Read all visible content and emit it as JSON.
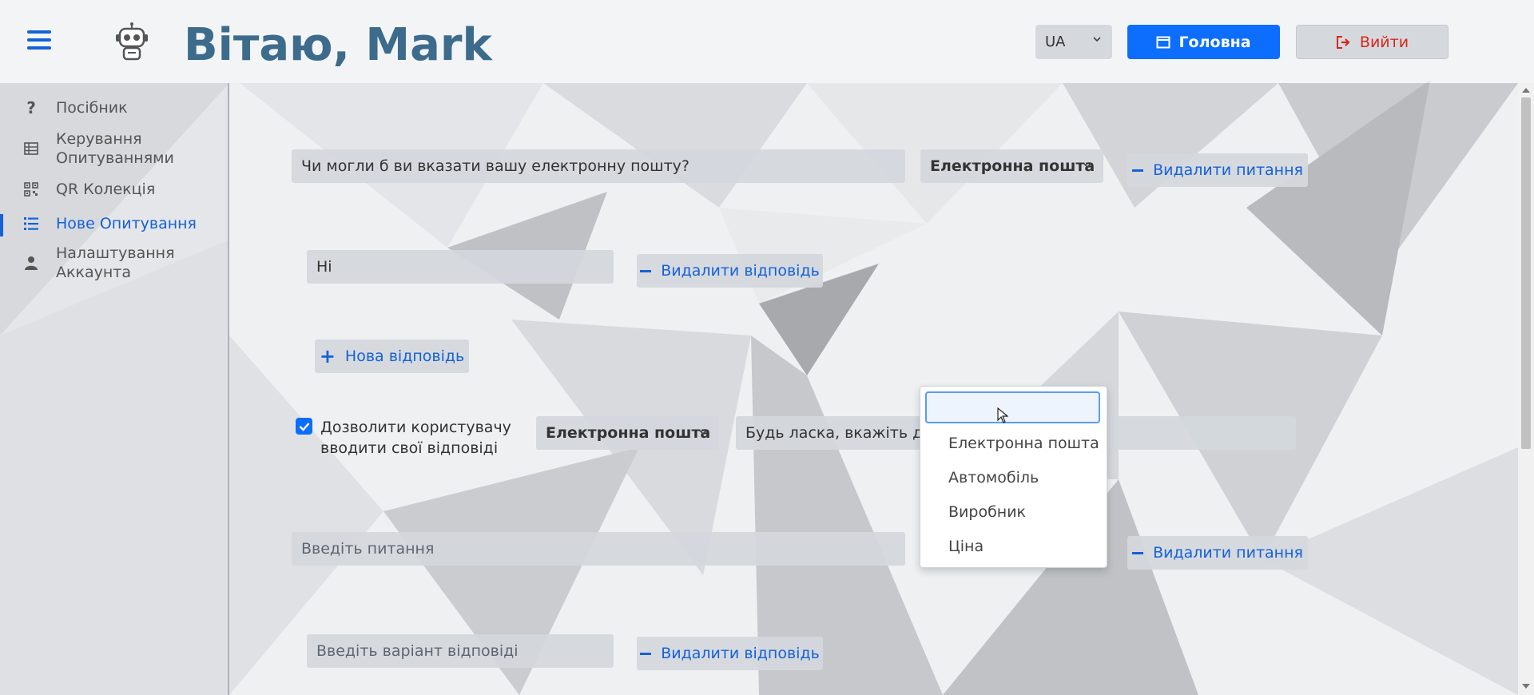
{
  "header": {
    "title": "Вітаю, Mark",
    "lang": "UA",
    "home_label": "Головна",
    "exit_label": "Вийти"
  },
  "sidebar": {
    "items": [
      {
        "label": "Посібник",
        "icon": "question-icon"
      },
      {
        "label": "Керування Опитуваннями",
        "icon": "survey-table-icon"
      },
      {
        "label": "QR Колекція",
        "icon": "qr-code-icon"
      },
      {
        "label": "Нове Опитування",
        "icon": "list-icon",
        "active": true
      },
      {
        "label": "Налаштування Аккаунта",
        "icon": "user-icon"
      }
    ]
  },
  "form": {
    "q1": {
      "text": "Чи могли б ви вказати вашу електронну пошту?",
      "type": "Електронна пошта",
      "delete_label": "Видалити питання"
    },
    "a1": {
      "text": "Ні",
      "delete_label": "Видалити відповідь"
    },
    "new_answer_label": "Нова відповідь",
    "allow_custom_label": "Дозволити користувачу вводити свої відповіді",
    "custom_type": "Електронна пошта",
    "custom_placeholder_visible": "Будь ласка, вкажіть дійсн",
    "q2": {
      "placeholder": "Введіть питання",
      "delete_label": "Видалити питання"
    },
    "a2": {
      "placeholder": "Введіть варіант відповіді",
      "delete_label": "Видалити відповідь"
    }
  },
  "dropdown": {
    "search_value": "",
    "options": [
      "Електронна пошта",
      "Автомобіль",
      "Виробник",
      "Ціна"
    ]
  },
  "colors": {
    "accent": "#0d6efd",
    "title": "#3d6b8c",
    "danger": "#d9261c"
  }
}
